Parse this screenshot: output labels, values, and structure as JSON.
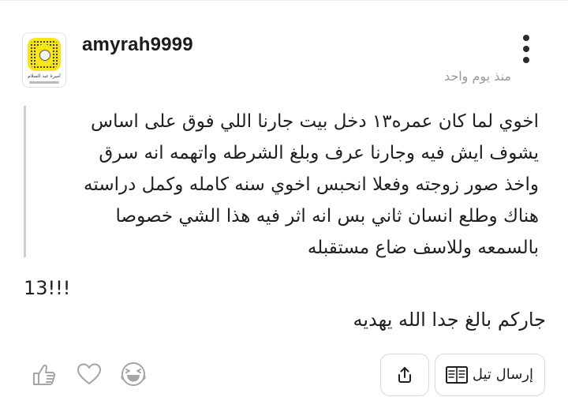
{
  "post": {
    "author": {
      "username": "amyrah9999",
      "avatar_caption": "أميرة عبد السلام"
    },
    "timestamp": "منذ يوم واحد",
    "quote_lines": [
      "اخوي لما كان عمره١٣ دخل بيت جارنا اللي فوق على اساس",
      "يشوف ايش فيه وجارنا عرف وبلغ الشرطه واتهمه انه سرق",
      "واخذ صور زوجته وفعلا انحبس اخوي سنه كامله وكمل دراسته",
      "هناك وطلع انسان ثاني بس انه اثر فيه هذا الشي خصوصا",
      "بالسمعه وللاسف ضاع مستقبله"
    ],
    "count_line": "13!!!",
    "reply_text": "جاركم بالغ جدا الله يهديه"
  },
  "actions": {
    "send_label": "إرسال تيل",
    "icons": {
      "thumbs_up": "thumbs-up-icon",
      "heart": "heart-icon",
      "laugh": "laughing-face-icon",
      "share": "share-icon",
      "book": "book-icon",
      "more": "more-vertical-icon"
    }
  },
  "colors": {
    "text": "#1f1f1f",
    "muted": "#9a9a9a",
    "icon_gray": "#a5a5a5",
    "border": "#dadada",
    "quote_bar": "#cfcfcf",
    "snapcode_yellow": "#f7e617"
  }
}
